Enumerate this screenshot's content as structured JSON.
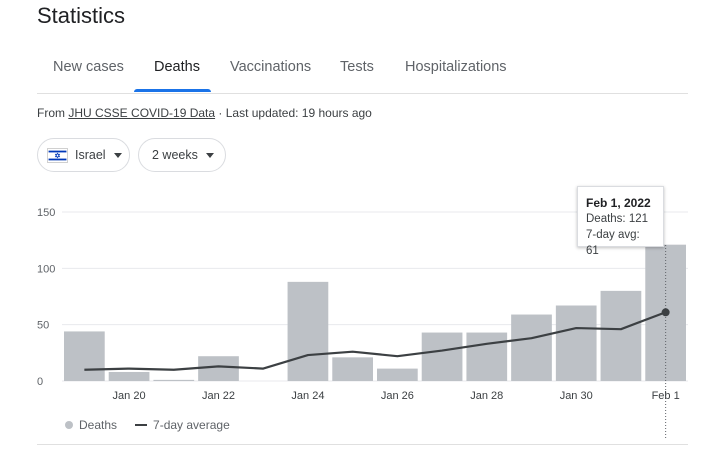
{
  "page_title": "Statistics",
  "tabs": [
    {
      "label": "New cases",
      "active": false
    },
    {
      "label": "Deaths",
      "active": true
    },
    {
      "label": "Vaccinations",
      "active": false
    },
    {
      "label": "Tests",
      "active": false
    },
    {
      "label": "Hospitalizations",
      "active": false
    }
  ],
  "source": {
    "prefix": "From ",
    "link_text": "JHU CSSE COVID-19 Data",
    "suffix": " · Last updated: 19 hours ago"
  },
  "filters": {
    "country": "Israel",
    "country_flag_icon": "israel-flag-icon",
    "range": "2 weeks"
  },
  "colors": {
    "bar": "#bdc1c6",
    "line": "#3c4043",
    "active_tab": "#1a73e8",
    "grid": "#e8eaed"
  },
  "tooltip": {
    "date": "Feb 1, 2022",
    "deaths_text": "Deaths: 121",
    "avg_text": "7-day avg: 61"
  },
  "legend": {
    "bars": "Deaths",
    "line": "7-day average"
  },
  "chart_data": {
    "type": "bar",
    "categories": [
      "Jan 19",
      "Jan 20",
      "Jan 21",
      "Jan 22",
      "Jan 23",
      "Jan 24",
      "Jan 25",
      "Jan 26",
      "Jan 27",
      "Jan 28",
      "Jan 29",
      "Jan 30",
      "Jan 31",
      "Feb 1"
    ],
    "series": [
      {
        "name": "Deaths",
        "type": "bar",
        "values": [
          44,
          8,
          1,
          22,
          0,
          88,
          21,
          11,
          43,
          43,
          59,
          67,
          80,
          121
        ]
      },
      {
        "name": "7-day average",
        "type": "line",
        "values": [
          10,
          11,
          10,
          13,
          11,
          23,
          26,
          22,
          27,
          33,
          38,
          47,
          46,
          61
        ]
      }
    ],
    "x_tick_labels": [
      "Jan 20",
      "Jan 22",
      "Jan 24",
      "Jan 26",
      "Jan 28",
      "Jan 30",
      "Feb 1"
    ],
    "y_ticks": [
      0,
      50,
      100,
      150
    ],
    "ylim": [
      0,
      150
    ],
    "highlighted_category": "Feb 1",
    "grid": true,
    "legend_position": "bottom-left"
  }
}
